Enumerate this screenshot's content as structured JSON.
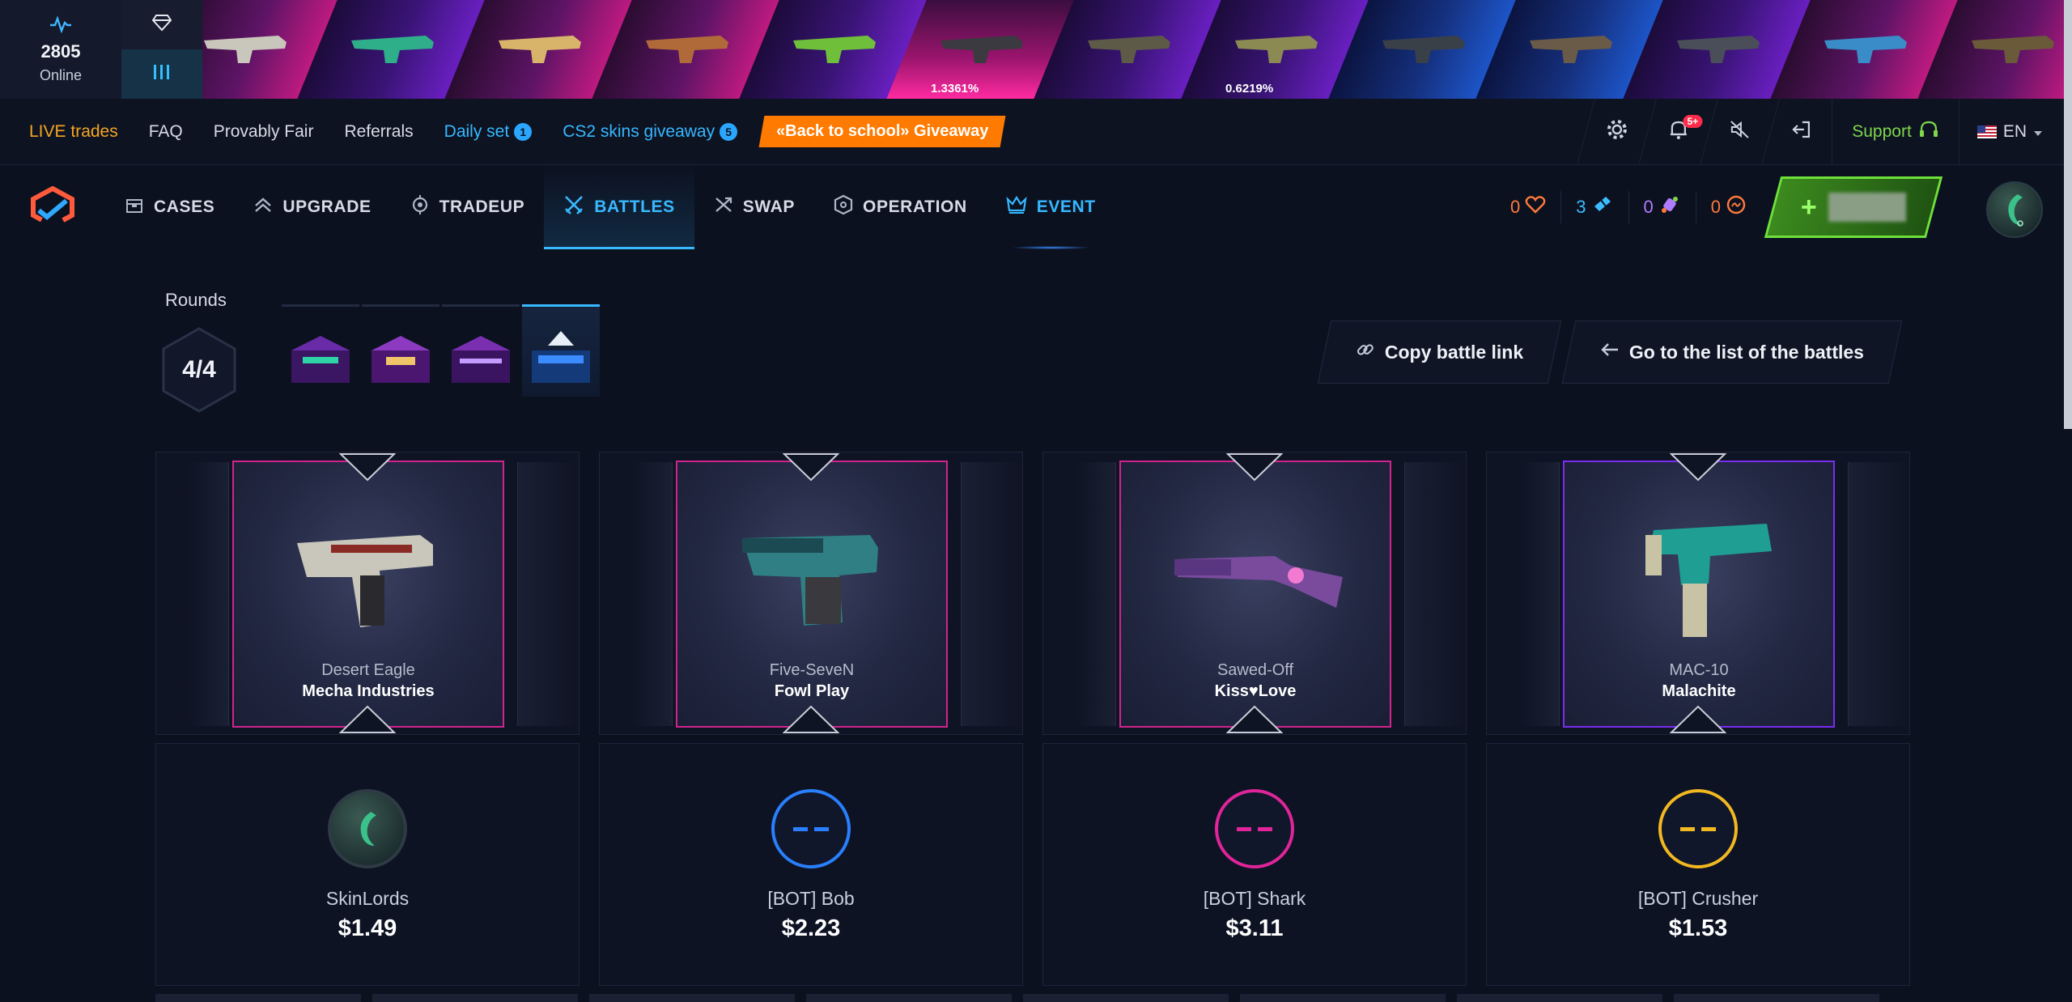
{
  "live": {
    "online_count": "2805",
    "online_label": "Online",
    "drops": [
      {
        "color": "pink",
        "chance": ""
      },
      {
        "color": "purple",
        "chance": ""
      },
      {
        "color": "pink",
        "chance": ""
      },
      {
        "color": "pink",
        "chance": ""
      },
      {
        "color": "purple",
        "chance": ""
      },
      {
        "color": "hot",
        "chance": "1.3361%"
      },
      {
        "color": "purple",
        "chance": ""
      },
      {
        "color": "purple",
        "chance": "0.6219%"
      },
      {
        "color": "blue",
        "chance": ""
      },
      {
        "color": "blue",
        "chance": ""
      },
      {
        "color": "purple",
        "chance": ""
      },
      {
        "color": "pink",
        "chance": ""
      },
      {
        "color": "pink",
        "chance": ""
      }
    ]
  },
  "topnav": {
    "live_trades": "LIVE trades",
    "faq": "FAQ",
    "provably_fair": "Provably Fair",
    "referrals": "Referrals",
    "daily_set": "Daily set",
    "daily_set_badge": "1",
    "giveaway": "CS2 skins giveaway",
    "giveaway_badge": "5",
    "promo": "«Back to school» Giveaway",
    "notif_badge": "5+",
    "support": "Support",
    "lang": "EN"
  },
  "mainnav": {
    "items": [
      {
        "label": "CASES",
        "icon": "box-icon"
      },
      {
        "label": "UPGRADE",
        "icon": "chevrons-up-icon"
      },
      {
        "label": "TRADEUP",
        "icon": "target-icon"
      },
      {
        "label": "BATTLES",
        "icon": "swords-icon"
      },
      {
        "label": "SWAP",
        "icon": "swap-icon"
      },
      {
        "label": "OPERATION",
        "icon": "hexagon-icon"
      },
      {
        "label": "EVENT",
        "icon": "crown-icon"
      }
    ],
    "counters": {
      "hearts": "0",
      "tickets": "3",
      "candy": "0",
      "coins": "0"
    }
  },
  "battle": {
    "rounds_label": "Rounds",
    "rounds_value": "4/4",
    "copy_link": "Copy battle link",
    "go_list": "Go to the list of the battles",
    "players": [
      {
        "weapon": "Desert Eagle",
        "skin": "Mecha Industries",
        "rarity": "pink",
        "name": "SkinLords",
        "value": "$1.49",
        "avatar": "user",
        "accent": "#2e3a44"
      },
      {
        "weapon": "Five-SeveN",
        "skin": "Fowl Play",
        "rarity": "pink",
        "name": "[BOT] Bob",
        "value": "$2.23",
        "avatar": "blue",
        "accent": "#2a7fff"
      },
      {
        "weapon": "Sawed-Off",
        "skin": "Kiss♥Love",
        "rarity": "pink",
        "name": "[BOT] Shark",
        "value": "$3.11",
        "avatar": "pink",
        "accent": "#e0249a"
      },
      {
        "weapon": "MAC-10",
        "skin": "Malachite",
        "rarity": "purple",
        "name": "[BOT] Crusher",
        "value": "$1.53",
        "avatar": "gold",
        "accent": "#f2b821"
      }
    ]
  },
  "colors": {
    "accent_blue": "#39b9ff",
    "live_orange": "#f5a623",
    "promo_orange": "#ff7a00",
    "deposit_green": "#6ee03a",
    "support_green": "#7ed64b"
  }
}
